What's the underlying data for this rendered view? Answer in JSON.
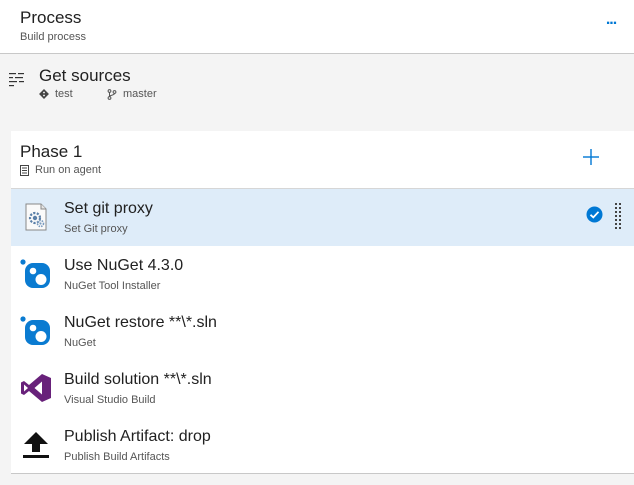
{
  "process": {
    "title": "Process",
    "subtitle": "Build process",
    "more_label": "..."
  },
  "sources": {
    "title": "Get sources",
    "repo": "test",
    "branch": "master"
  },
  "phase": {
    "title": "Phase 1",
    "subtitle": "Run on agent"
  },
  "tasks": [
    {
      "name": "Set git proxy",
      "desc": "Set Git proxy",
      "icon": "script-gear-icon",
      "selected": true
    },
    {
      "name": "Use NuGet 4.3.0",
      "desc": "NuGet Tool Installer",
      "icon": "nuget-icon",
      "selected": false
    },
    {
      "name": "NuGet restore **\\*.sln",
      "desc": "NuGet",
      "icon": "nuget-icon",
      "selected": false
    },
    {
      "name": "Build solution **\\*.sln",
      "desc": "Visual Studio Build",
      "icon": "visual-studio-icon",
      "selected": false
    },
    {
      "name": "Publish Artifact: drop",
      "desc": "Publish Build Artifacts",
      "icon": "upload-icon",
      "selected": false
    }
  ],
  "colors": {
    "accent": "#0078d4",
    "selected_row": "#deecf9",
    "nuget_blue": "#0a7bd1",
    "vs_purple": "#68217a"
  }
}
